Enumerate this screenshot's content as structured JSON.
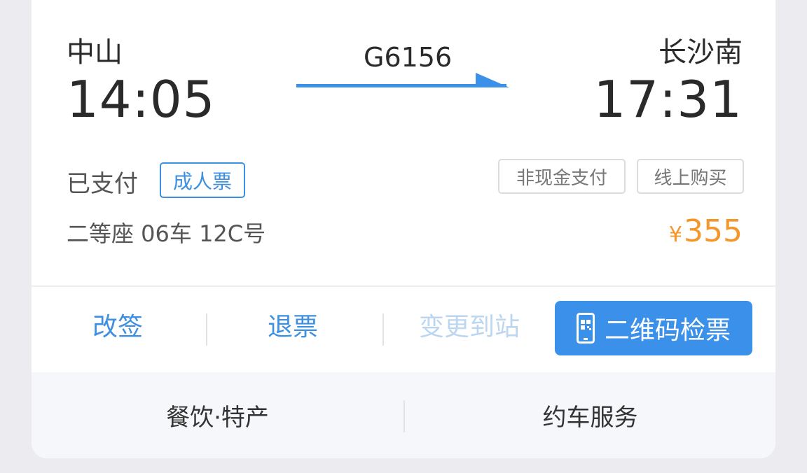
{
  "trip": {
    "from_station": "中山",
    "to_station": "长沙南",
    "train_no": "G6156",
    "depart_time": "14:05",
    "arrive_time": "17:31"
  },
  "ticket": {
    "pay_status": "已支付",
    "ticket_type": "成人票",
    "tag_cashless": "非现金支付",
    "tag_online": "线上购买",
    "seat_info": "二等座 06车 12C号",
    "currency": "¥",
    "price": "355"
  },
  "actions": {
    "change": "改签",
    "refund": "退票",
    "change_station": "变更到站",
    "qr_check": "二维码检票"
  },
  "services": {
    "food": "餐饮·特产",
    "car": "约车服务"
  },
  "colors": {
    "accent": "#3b91ea",
    "price": "#f5962a"
  },
  "icons": {
    "arrow": "right-arrow-icon",
    "qr": "phone-qr-icon"
  }
}
